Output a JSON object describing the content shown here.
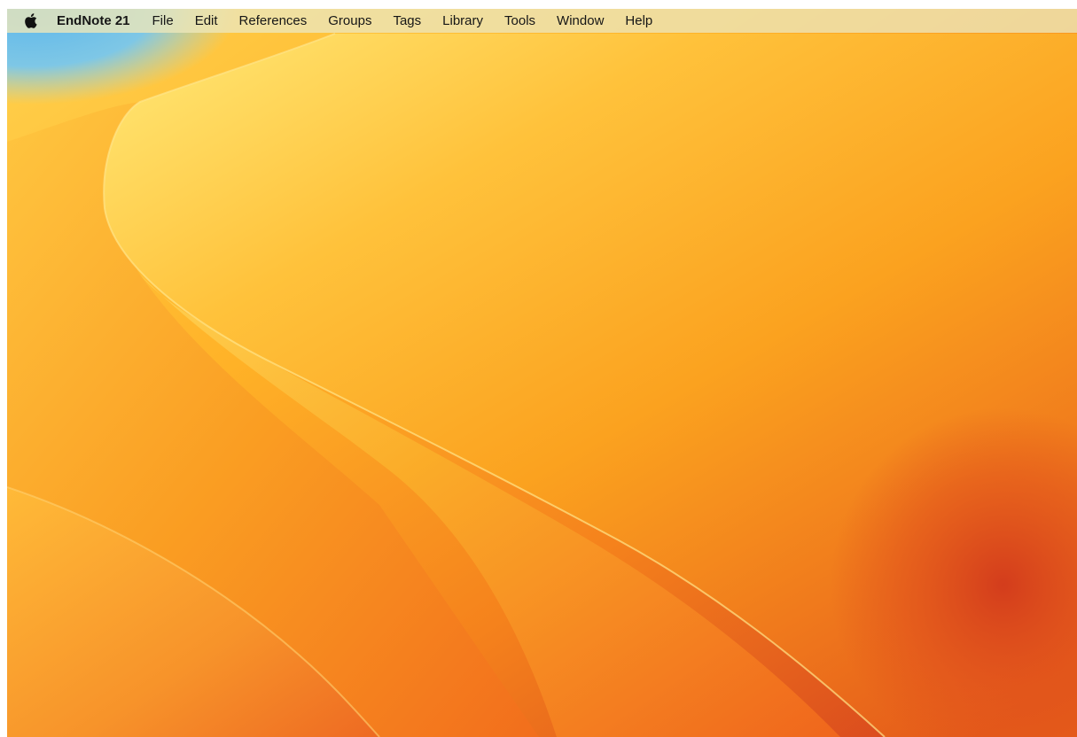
{
  "menubar": {
    "apple_icon": "apple-logo-icon",
    "app_name": "EndNote 21",
    "items": [
      {
        "label": "File"
      },
      {
        "label": "Edit"
      },
      {
        "label": "References"
      },
      {
        "label": "Groups"
      },
      {
        "label": "Tags"
      },
      {
        "label": "Library"
      },
      {
        "label": "Tools"
      },
      {
        "label": "Window"
      },
      {
        "label": "Help"
      }
    ]
  },
  "desktop": {
    "wallpaper": "macos-ventura-orange-waves",
    "colors": {
      "sky": "#5fb8e8",
      "highlight": "#ffe574",
      "amber": "#ffb12a",
      "orange": "#f47a1f",
      "red": "#d4351d"
    }
  }
}
